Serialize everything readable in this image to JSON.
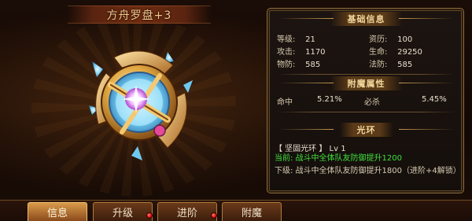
{
  "item": {
    "title": "方舟罗盘+3"
  },
  "panel": {
    "basic": {
      "heading": "基础信息",
      "stats": [
        {
          "label": "等级:",
          "value": "21"
        },
        {
          "label": "资历:",
          "value": "100"
        },
        {
          "label": "攻击:",
          "value": "1170"
        },
        {
          "label": "生命:",
          "value": "29250"
        },
        {
          "label": "物防:",
          "value": "585"
        },
        {
          "label": "法防:",
          "value": "585"
        }
      ]
    },
    "magic": {
      "heading": "附魔属性",
      "stats": [
        {
          "label": "命中",
          "value": "5.21%"
        },
        {
          "label": "必杀",
          "value": "5.45%"
        }
      ]
    },
    "aura": {
      "heading": "光环",
      "name": "【 坚固光环 】",
      "level": "Lv 1",
      "current": "当前: 战斗中全体队友防御提升1200",
      "next": "下级: 战斗中全体队友防御提升1800（进阶+4解锁）"
    }
  },
  "tabs": [
    {
      "label": "信息",
      "active": true
    },
    {
      "label": "升级",
      "active": false
    },
    {
      "label": "进阶",
      "active": false
    },
    {
      "label": "附魔",
      "active": false
    }
  ],
  "colors": {
    "aura_current": "#3ee03a",
    "aura_next": "#d8cbb3",
    "panel_border": "#8a6a3a",
    "heading": "#f0d69a",
    "notification_dot": "#d80e0e"
  },
  "icons": [
    "compass-artifact-icon",
    "notification-dot-icon"
  ]
}
